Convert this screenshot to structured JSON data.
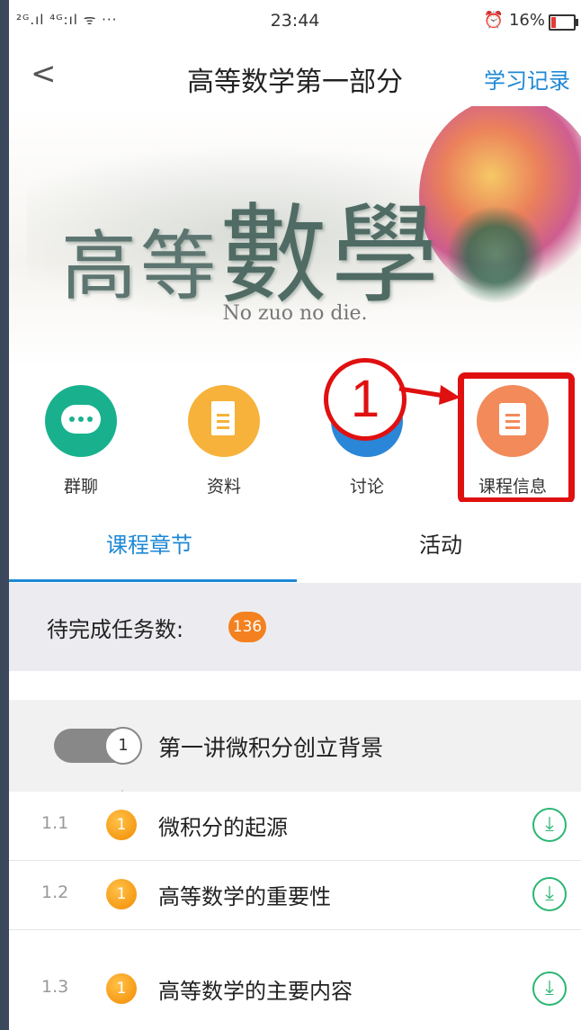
{
  "status_bar": {
    "signal": "²ᴳ.ıl ⁴ᴳ:ıl ᯤ ···",
    "time": "23:44",
    "battery": "⏰ 16%"
  },
  "nav": {
    "back_glyph": "<",
    "title": "高等数学第一部分",
    "record": "学习记录"
  },
  "banner": {
    "small_text": "高等",
    "large_text": "數學",
    "motto": "No zuo no die."
  },
  "icons": [
    {
      "label": "群聊",
      "icon": "chat-icon"
    },
    {
      "label": "资料",
      "icon": "document-icon"
    },
    {
      "label": "讨论",
      "icon": "discussion-icon"
    },
    {
      "label": "课程信息",
      "icon": "notepad-icon"
    }
  ],
  "annotation": {
    "number": "1"
  },
  "tabs": [
    {
      "label": "课程章节",
      "active": true
    },
    {
      "label": "活动",
      "active": false
    }
  ],
  "pending": {
    "label": "待完成任务数:",
    "count": "136"
  },
  "chapter": {
    "number": "1",
    "title": "第一讲微积分创立背景"
  },
  "lessons": [
    {
      "index": "1.1",
      "badge": "1",
      "title": "微积分的起源"
    },
    {
      "index": "1.2",
      "badge": "1",
      "title": "高等数学的重要性"
    },
    {
      "index": "1.3",
      "badge": "1",
      "title": "高等数学的主要内容"
    }
  ],
  "download_glyph": "⤓"
}
